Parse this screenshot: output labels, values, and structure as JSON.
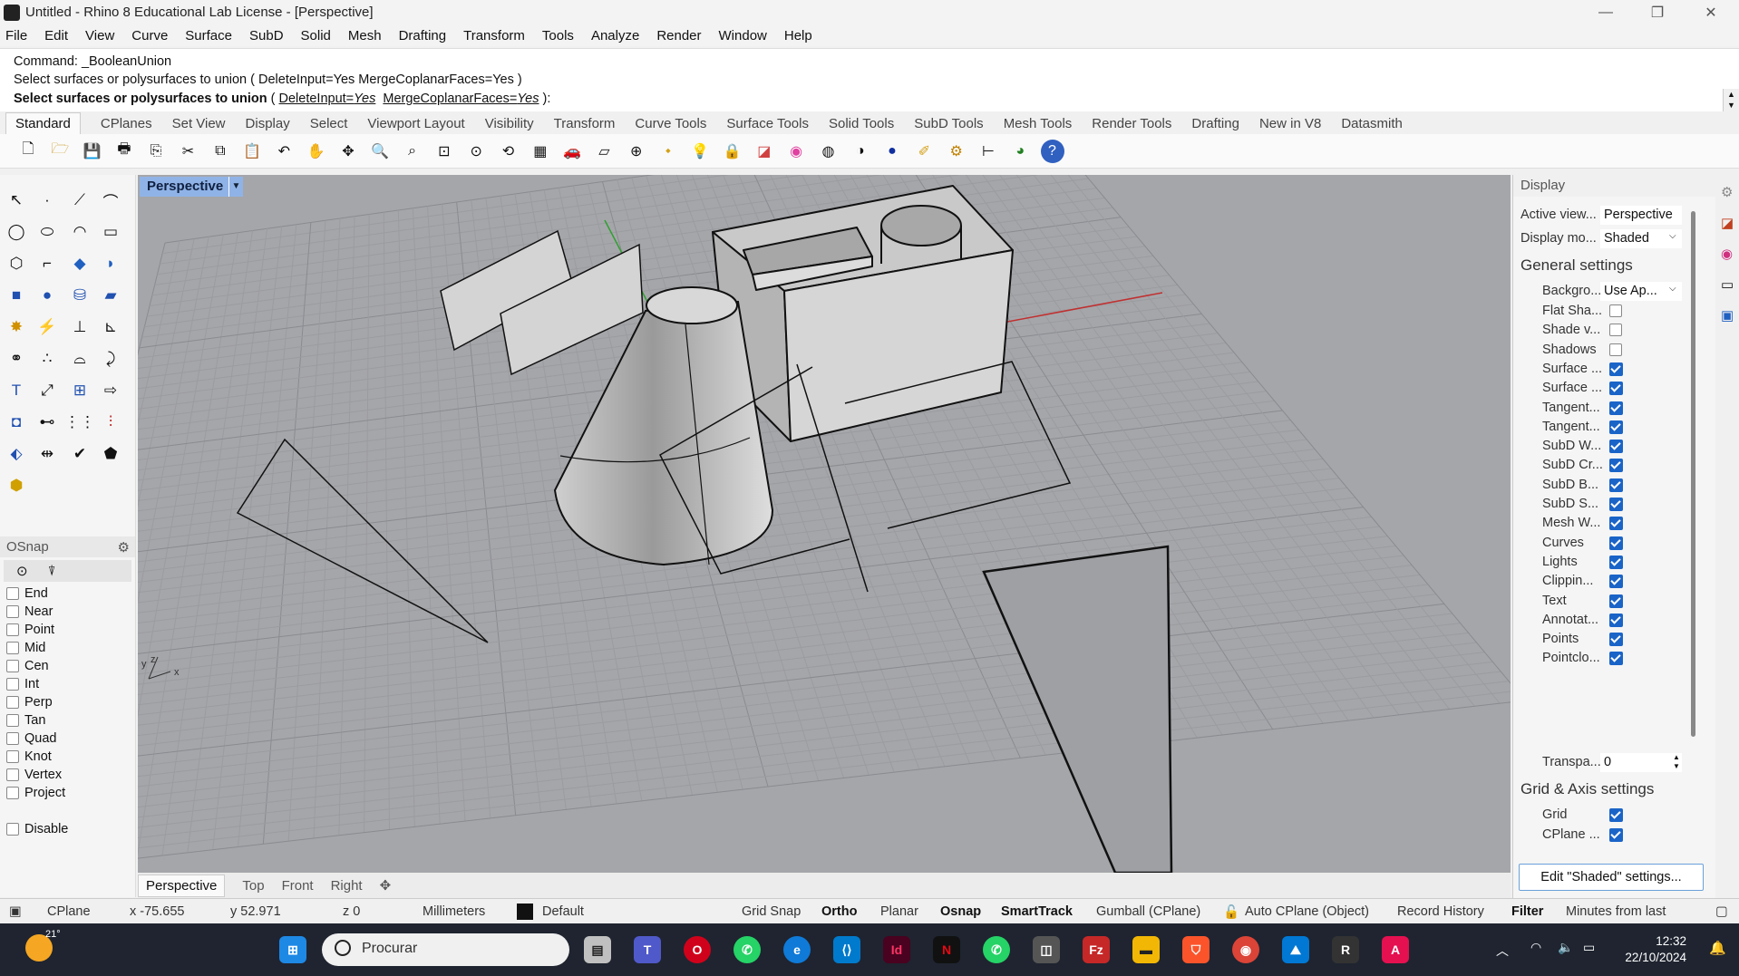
{
  "window": {
    "title": "Untitled - Rhino 8 Educational Lab License - [Perspective]"
  },
  "menu": [
    "File",
    "Edit",
    "View",
    "Curve",
    "Surface",
    "SubD",
    "Solid",
    "Mesh",
    "Drafting",
    "Transform",
    "Tools",
    "Analyze",
    "Render",
    "Window",
    "Help"
  ],
  "command": {
    "line1": "Command: _BooleanUnion",
    "line2": "Select surfaces or polysurfaces to union ( DeleteInput=Yes  MergeCoplanarFaces=Yes )",
    "prompt_bold": "Select surfaces or polysurfaces to union",
    "prompt_open": " ( ",
    "opt1_name": "DeleteInput=",
    "opt1_val": "Yes",
    "opt2_name": "MergeCoplanarFaces=",
    "opt2_val": "Yes",
    "prompt_close": " ):"
  },
  "toolbar_tabs": [
    "Standard",
    "CPlanes",
    "Set View",
    "Display",
    "Select",
    "Viewport Layout",
    "Visibility",
    "Transform",
    "Curve Tools",
    "Surface Tools",
    "Solid Tools",
    "SubD Tools",
    "Mesh Tools",
    "Render Tools",
    "Drafting",
    "New in V8",
    "Datasmith"
  ],
  "viewport": {
    "label": "Perspective"
  },
  "view_tabs": [
    "Perspective",
    "Top",
    "Front",
    "Right"
  ],
  "axis": {
    "x": "x",
    "y": "y",
    "z": "z"
  },
  "osnap": {
    "title": "OSnap",
    "items": [
      "End",
      "Near",
      "Point",
      "Mid",
      "Cen",
      "Int",
      "Perp",
      "Tan",
      "Quad",
      "Knot",
      "Vertex",
      "Project"
    ],
    "disable": "Disable"
  },
  "display_panel": {
    "title": "Display",
    "active_view_label": "Active view...",
    "active_view_value": "Perspective",
    "display_mode_label": "Display mo...",
    "display_mode_value": "Shaded",
    "general_title": "General settings",
    "background_label": "Backgro...",
    "background_value": "Use Ap...",
    "flags": [
      {
        "label": "Flat Sha...",
        "checked": false
      },
      {
        "label": "Shade v...",
        "checked": false
      },
      {
        "label": "Shadows",
        "checked": false
      },
      {
        "label": "Surface ...",
        "checked": true
      },
      {
        "label": "Surface ...",
        "checked": true
      },
      {
        "label": "Tangent...",
        "checked": true
      },
      {
        "label": "Tangent...",
        "checked": true
      },
      {
        "label": "SubD W...",
        "checked": true
      },
      {
        "label": "SubD Cr...",
        "checked": true
      },
      {
        "label": "SubD B...",
        "checked": true
      },
      {
        "label": "SubD S...",
        "checked": true
      },
      {
        "label": "Mesh W...",
        "checked": true
      },
      {
        "label": "Curves",
        "checked": true
      },
      {
        "label": "Lights",
        "checked": true
      },
      {
        "label": "Clippin...",
        "checked": true
      },
      {
        "label": "Text",
        "checked": true
      },
      {
        "label": "Annotat...",
        "checked": true
      },
      {
        "label": "Points",
        "checked": true
      },
      {
        "label": "Pointclo...",
        "checked": true
      }
    ],
    "transparency_label": "Transpa...",
    "transparency_value": "0",
    "grid_title": "Grid & Axis settings",
    "grid_label": "Grid",
    "cplane_label": "CPlane ...",
    "edit_button": "Edit \"Shaded\" settings..."
  },
  "status": {
    "cplane": "CPlane",
    "x": "x -75.655",
    "y": "y 52.971",
    "z": "z 0",
    "units": "Millimeters",
    "layer": "Default",
    "grid_snap": "Grid Snap",
    "ortho": "Ortho",
    "planar": "Planar",
    "osnap": "Osnap",
    "smarttrack": "SmartTrack",
    "gumball": "Gumball (CPlane)",
    "autocplane": "Auto CPlane (Object)",
    "record_history": "Record History",
    "filter": "Filter",
    "minutes": "Minutes from last"
  },
  "taskbar": {
    "temperature": "21°",
    "search_placeholder": "Procurar",
    "time": "12:32",
    "date": "22/10/2024"
  },
  "colors": {
    "viewport_bg": "#a5a6aa",
    "x_axis": "#c03030",
    "y_axis": "#30a030",
    "accent": "#1a64c8"
  }
}
